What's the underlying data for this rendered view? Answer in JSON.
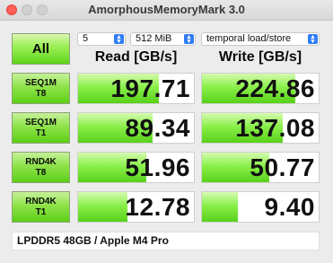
{
  "window": {
    "title": "AmorphousMemoryMark 3.0"
  },
  "controls": {
    "all_label": "All",
    "count": "5",
    "size": "512 MiB",
    "mode": "temporal load/store"
  },
  "headers": {
    "read": "Read [GB/s]",
    "write": "Write [GB/s]"
  },
  "rows": [
    {
      "line1": "SEQ1M",
      "line2": "T8",
      "read": "197.71",
      "write": "224.86",
      "read_fill": 0.7,
      "write_fill": 0.8
    },
    {
      "line1": "SEQ1M",
      "line2": "T1",
      "read": "89.34",
      "write": "137.08",
      "read_fill": 0.64,
      "write_fill": 0.69
    },
    {
      "line1": "RND4K",
      "line2": "T8",
      "read": "51.96",
      "write": "50.77",
      "read_fill": 0.59,
      "write_fill": 0.58
    },
    {
      "line1": "RND4K",
      "line2": "T1",
      "read": "12.78",
      "write": "9.40",
      "read_fill": 0.43,
      "write_fill": 0.31
    }
  ],
  "status": "LPDDR5 48GB / Apple M4 Pro"
}
